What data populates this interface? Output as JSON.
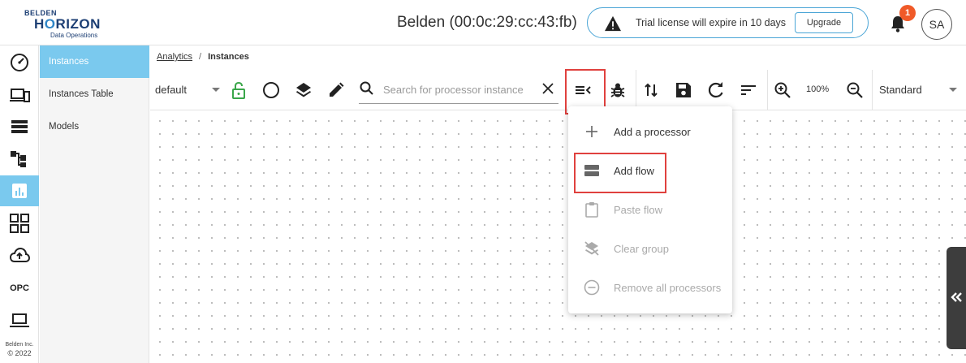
{
  "header": {
    "logo_line1": "BELDEN",
    "logo_line2_pre": "H",
    "logo_line2_o": "O",
    "logo_line2_post": "RIZON",
    "logo_line3": "Data Operations",
    "device_title": "Belden (00:0c:29:cc:43:fb)",
    "trial_message": "Trial license will expire in 10 days",
    "upgrade_label": "Upgrade",
    "notification_count": "1",
    "avatar_initials": "SA"
  },
  "icon_rail": {
    "items": [
      {
        "name": "dashboard-gauge-icon"
      },
      {
        "name": "devices-icon"
      },
      {
        "name": "list-icon"
      },
      {
        "name": "topology-icon"
      },
      {
        "name": "analytics-icon",
        "active": true
      },
      {
        "name": "apps-grid-icon"
      },
      {
        "name": "cloud-upload-icon"
      },
      {
        "name": "opc-icon",
        "label": "OPC"
      },
      {
        "name": "laptop-icon"
      }
    ],
    "copyright_company": "Belden Inc.",
    "copyright_year": "© 2022"
  },
  "subnav": {
    "items": [
      {
        "label": "Instances",
        "active": true
      },
      {
        "label": "Instances Table"
      },
      {
        "label": "Models"
      }
    ]
  },
  "breadcrumb": {
    "link": "Analytics",
    "separator": "/",
    "current": "Instances"
  },
  "toolbar": {
    "group_select": "default",
    "search_placeholder": "Search for processor instance",
    "zoom_level": "100%",
    "view_select": "Standard"
  },
  "menu": {
    "items": [
      {
        "label": "Add a processor",
        "icon": "plus-icon",
        "enabled": true
      },
      {
        "label": "Add flow",
        "icon": "flow-icon",
        "enabled": true,
        "highlighted": true
      },
      {
        "label": "Paste flow",
        "icon": "clipboard-icon",
        "enabled": false
      },
      {
        "label": "Clear group",
        "icon": "layers-clear-icon",
        "enabled": false
      },
      {
        "label": "Remove all processors",
        "icon": "minus-circle-icon",
        "enabled": false
      }
    ]
  },
  "colors": {
    "accent": "#7ac9ee",
    "brand": "#1d3f74",
    "highlight": "#e0413e",
    "badge": "#f05a28"
  }
}
